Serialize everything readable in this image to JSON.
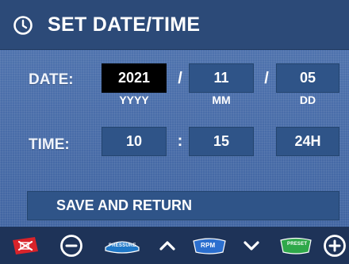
{
  "header": {
    "title": "SET DATE/TIME",
    "icon": "clock-icon"
  },
  "date": {
    "label": "DATE:",
    "year": {
      "value": "2021",
      "unit": "YYYY",
      "selected": true
    },
    "month": {
      "value": "11",
      "unit": "MM"
    },
    "day": {
      "value": "05",
      "unit": "DD"
    },
    "separator": "/"
  },
  "time": {
    "label": "TIME:",
    "hour": {
      "value": "10"
    },
    "minute": {
      "value": "15"
    },
    "format": "24H",
    "separator": ":"
  },
  "save_button": {
    "label": "SAVE AND RETURN"
  },
  "bottom_bar": {
    "items": [
      {
        "icon": "motor-off-icon"
      },
      {
        "icon": "minus-circle-icon"
      },
      {
        "icon": "pressure-icon",
        "label": "PRESSURE"
      },
      {
        "icon": "chevron-up-icon"
      },
      {
        "icon": "rpm-icon",
        "label": "RPM"
      },
      {
        "icon": "chevron-down-icon"
      },
      {
        "icon": "preset-icon",
        "label": "PRESET"
      },
      {
        "icon": "plus-circle-icon"
      }
    ]
  },
  "colors": {
    "background": "#4a6fa8",
    "header": "#2c4a78",
    "field": "#2f5488",
    "selected_field": "#000000",
    "bottom_bar": "#1e3358",
    "danger": "#d8232a",
    "pressure_badge": "#1f78c8",
    "rpm_badge": "#2b6fcf",
    "preset_badge": "#2fa84a"
  }
}
